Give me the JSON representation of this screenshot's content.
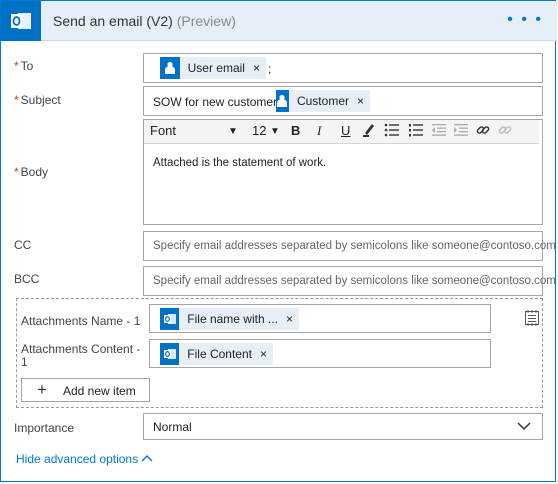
{
  "header": {
    "title": "Send an email (V2)",
    "preview": "(Preview)",
    "more": "• • •"
  },
  "to": {
    "label": "To",
    "token": "User email",
    "separator": ";"
  },
  "subject": {
    "label": "Subject",
    "text": "SOW for new customer:",
    "token": "Customer"
  },
  "body": {
    "label": "Body",
    "font": "Font",
    "size": "12",
    "text": "Attached is the statement of work."
  },
  "cc": {
    "label": "CC",
    "placeholder": "Specify email addresses separated by semicolons like someone@contoso.com"
  },
  "bcc": {
    "label": "BCC",
    "placeholder": "Specify email addresses separated by semicolons like someone@contoso.com"
  },
  "attachments": {
    "name_label": "Attachments Name - 1",
    "name_token": "File name with ...",
    "content_label_line1": "Attachments Content -",
    "content_label_line2": "1",
    "content_token": "File Content",
    "add_label": "Add new item"
  },
  "importance": {
    "label": "Importance",
    "value": "Normal"
  },
  "advanced": {
    "label": "Hide advanced options"
  },
  "token_remove": "×",
  "colors": {
    "accent": "#0078d4",
    "office": "#0072c6",
    "required": "#d83b01"
  },
  "icons": [
    "outlook-icon",
    "user-icon",
    "office-icon",
    "bold-icon",
    "italic-icon",
    "underline-icon",
    "highlight-icon",
    "bullet-list-icon",
    "numbered-list-icon",
    "outdent-icon",
    "indent-icon",
    "link-icon",
    "unlink-icon",
    "plus-icon",
    "chevron-down-icon",
    "chevron-up-icon",
    "array-toggle-icon"
  ]
}
